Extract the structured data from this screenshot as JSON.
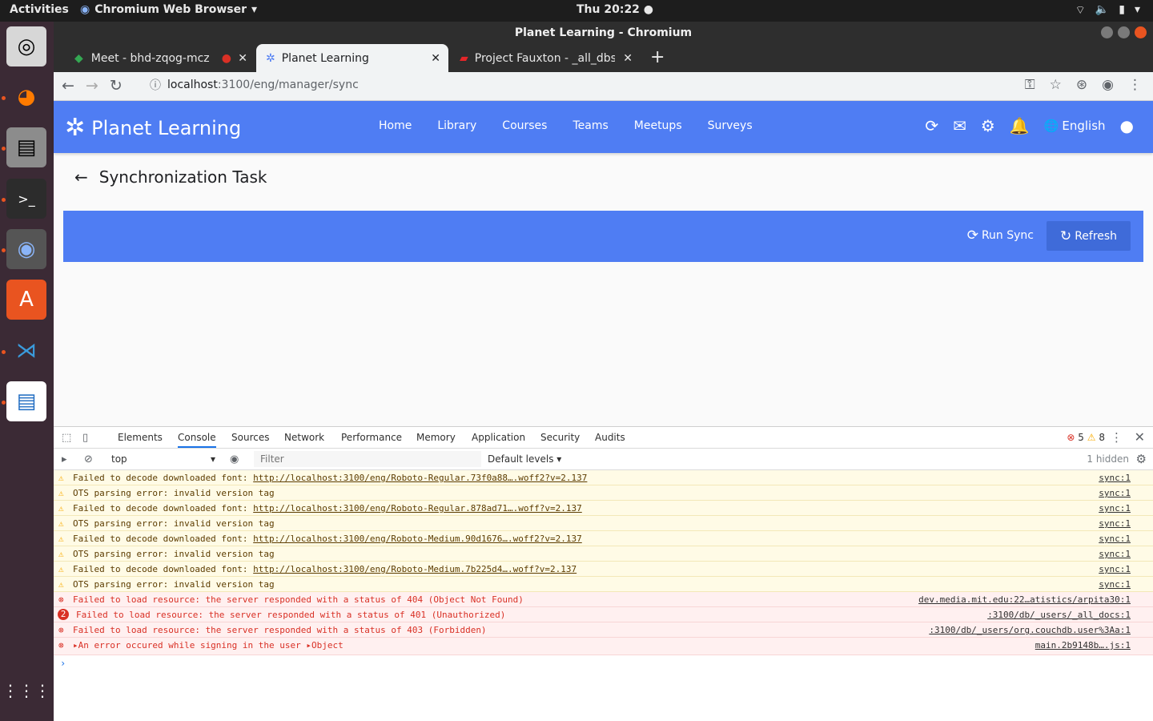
{
  "os": {
    "activities": "Activities",
    "app_name": "Chromium Web Browser",
    "clock": "Thu 20:22",
    "tray_icons": [
      "wifi-icon",
      "volume-icon",
      "battery-icon",
      "power-menu-icon"
    ]
  },
  "dock": {
    "apps": [
      "rhythmbox",
      "firefox",
      "files",
      "terminal",
      "chromium",
      "software",
      "vscode",
      "writer"
    ]
  },
  "window": {
    "title": "Planet Learning - Chromium"
  },
  "tabs": [
    {
      "label": "Meet - bhd-zqog-mcz"
    },
    {
      "label": "Planet Learning"
    },
    {
      "label": "Project Fauxton - _all_dbs"
    }
  ],
  "omnibox": {
    "host": "localhost",
    "path": ":3100/eng/manager/sync"
  },
  "app": {
    "brand": "Planet Learning",
    "nav": [
      "Home",
      "Library",
      "Courses",
      "Teams",
      "Meetups",
      "Surveys"
    ],
    "language": "English"
  },
  "page": {
    "title": "Synchronization Task",
    "run_sync": "Run Sync",
    "refresh": "Refresh"
  },
  "devtools": {
    "tabs": [
      "Elements",
      "Console",
      "Sources",
      "Network",
      "Performance",
      "Memory",
      "Application",
      "Security",
      "Audits"
    ],
    "active_tab": "Console",
    "error_count": "5",
    "warning_count": "8",
    "context": "top",
    "filter_placeholder": "Filter",
    "levels": "Default levels",
    "hidden": "1 hidden",
    "logs": [
      {
        "level": "warn",
        "text": "Failed to decode downloaded font: ",
        "link": "http://localhost:3100/eng/Roboto-Regular.73f0a88….woff2?v=2.137",
        "src": "sync:1"
      },
      {
        "level": "warn",
        "text": "OTS parsing error: invalid version tag",
        "link": "",
        "src": "sync:1"
      },
      {
        "level": "warn",
        "text": "Failed to decode downloaded font: ",
        "link": "http://localhost:3100/eng/Roboto-Regular.878ad71….woff?v=2.137",
        "src": "sync:1"
      },
      {
        "level": "warn",
        "text": "OTS parsing error: invalid version tag",
        "link": "",
        "src": "sync:1"
      },
      {
        "level": "warn",
        "text": "Failed to decode downloaded font: ",
        "link": "http://localhost:3100/eng/Roboto-Medium.90d1676….woff2?v=2.137",
        "src": "sync:1"
      },
      {
        "level": "warn",
        "text": "OTS parsing error: invalid version tag",
        "link": "",
        "src": "sync:1"
      },
      {
        "level": "warn",
        "text": "Failed to decode downloaded font: ",
        "link": "http://localhost:3100/eng/Roboto-Medium.7b225d4….woff?v=2.137",
        "src": "sync:1"
      },
      {
        "level": "warn",
        "text": "OTS parsing error: invalid version tag",
        "link": "",
        "src": "sync:1"
      },
      {
        "level": "error",
        "text": "Failed to load resource: the server responded with a status of 404 (Object Not Found)",
        "link": "",
        "src": "dev.media.mit.edu:22…atistics/arpita30:1"
      },
      {
        "level": "error",
        "badge": "2",
        "text": "Failed to load resource: the server responded with a status of 401 (Unauthorized)",
        "link": "",
        "src": ":3100/db/_users/_all_docs:1"
      },
      {
        "level": "error",
        "text": "Failed to load resource: the server responded with a status of 403 (Forbidden)",
        "link": "",
        "src": ":3100/db/_users/org.couchdb.user%3Aa:1"
      },
      {
        "level": "error",
        "text": "▸An error occured while signing in the user ▸Object",
        "link": "",
        "src": "main.2b9148b….js:1"
      }
    ]
  }
}
